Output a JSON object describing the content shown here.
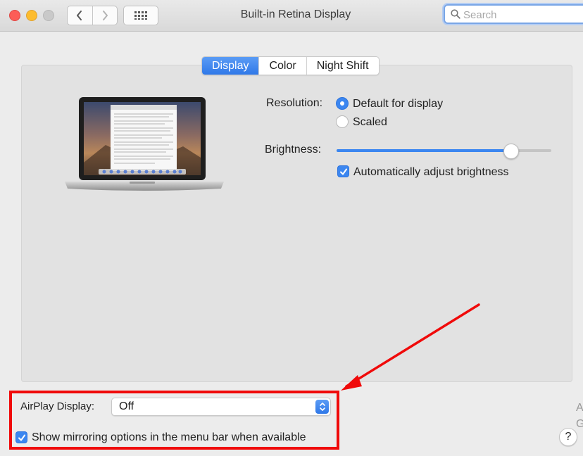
{
  "window": {
    "title": "Built-in Retina Display",
    "search_placeholder": "Search"
  },
  "toolbar": {
    "back_icon": "chevron-left-icon",
    "forward_icon": "chevron-right-icon",
    "grid_icon": "show-all-grid-icon"
  },
  "tabs": [
    {
      "label": "Display",
      "active": true
    },
    {
      "label": "Color",
      "active": false
    },
    {
      "label": "Night Shift",
      "active": false
    }
  ],
  "resolution": {
    "label": "Resolution:",
    "options": [
      {
        "label": "Default for display",
        "selected": true
      },
      {
        "label": "Scaled",
        "selected": false
      }
    ]
  },
  "brightness": {
    "label": "Brightness:",
    "level": 0.81,
    "auto_label": "Automatically adjust brightness",
    "auto_checked": true
  },
  "airplay": {
    "label": "AirPlay Display:",
    "value": "Off"
  },
  "mirroring": {
    "label": "Show mirroring options in the menu bar when available",
    "checked": true
  },
  "help_label": "?",
  "edge_glyphs": [
    "A",
    "G"
  ],
  "colors": {
    "accent": "#3b86f0",
    "highlight_box": "#f00a0a",
    "arrow": "#f00a0a"
  }
}
